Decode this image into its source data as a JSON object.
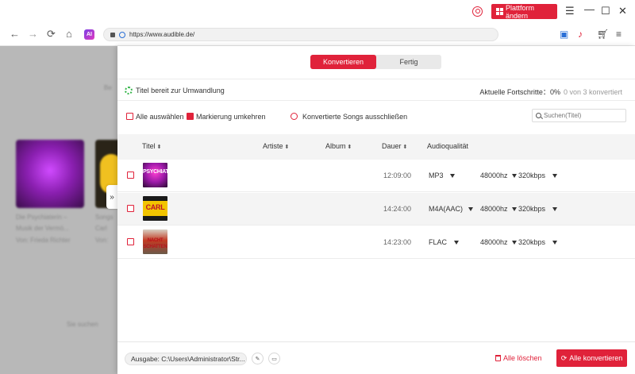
{
  "titlebar": {
    "platform_label": "Plattform ändern",
    "icons": {
      "user": "user-circle-icon",
      "menu": "hamburger-icon",
      "minimize": "minimize-icon",
      "maximize": "maximize-icon",
      "close": "close-icon"
    },
    "accent": "#e0223a"
  },
  "browser": {
    "url": "https://www.audible.de/",
    "ai_label": "AI",
    "icons": [
      "back-icon",
      "forward-icon",
      "reload-icon",
      "home-icon",
      "ai-icon",
      "save-icon",
      "add-music-icon",
      "cart-icon",
      "playlist-icon"
    ]
  },
  "background_page": {
    "snippet_top": "Be",
    "card1_line1": "Die Psychiaterin –",
    "card1_line2": "Musik der Vermö...",
    "card1_line3": "Von: Frieda Richter",
    "card2_line1": "Songs",
    "card2_line2": "Carl",
    "card2_line3": "Von:",
    "bottom_text": "Sie suchen"
  },
  "tabs": {
    "convert": "Konvertieren",
    "done": "Fertig"
  },
  "status": {
    "ready_text": "Titel bereit zur Umwandlung",
    "progress_label": "Aktuelle Fortschritte：",
    "progress_percent": "0%",
    "progress_count": "0 von 3 konvertiert"
  },
  "actions": {
    "select_all": "Alle auswählen",
    "invert_selection": "Markierung umkehren",
    "exclude_converted": "Konvertierte Songs ausschließen",
    "search_placeholder": "Suchen(Titel)"
  },
  "columns": {
    "title": "Titel",
    "artist": "Artiste",
    "album": "Album",
    "duration": "Dauer",
    "quality": "Audioqualität"
  },
  "tracks": [
    {
      "cover_text": "PSYCHIATERIN",
      "duration": "12:09:00",
      "format": "MP3",
      "sample_rate": "48000hz",
      "bitrate": "320kbps"
    },
    {
      "cover_text": "CARL",
      "duration": "14:24:00",
      "format": "M4A(AAC)",
      "sample_rate": "48000hz",
      "bitrate": "320kbps"
    },
    {
      "cover_text": "NACHT SCHATTEN",
      "duration": "14:23:00",
      "format": "FLAC",
      "sample_rate": "48000hz",
      "bitrate": "320kbps"
    }
  ],
  "footer": {
    "output_label": "Ausgabe:",
    "output_path": "C:\\Users\\Administrator\\Str...",
    "delete_all": "Alle löschen",
    "convert_all": "Alle konvertieren"
  }
}
